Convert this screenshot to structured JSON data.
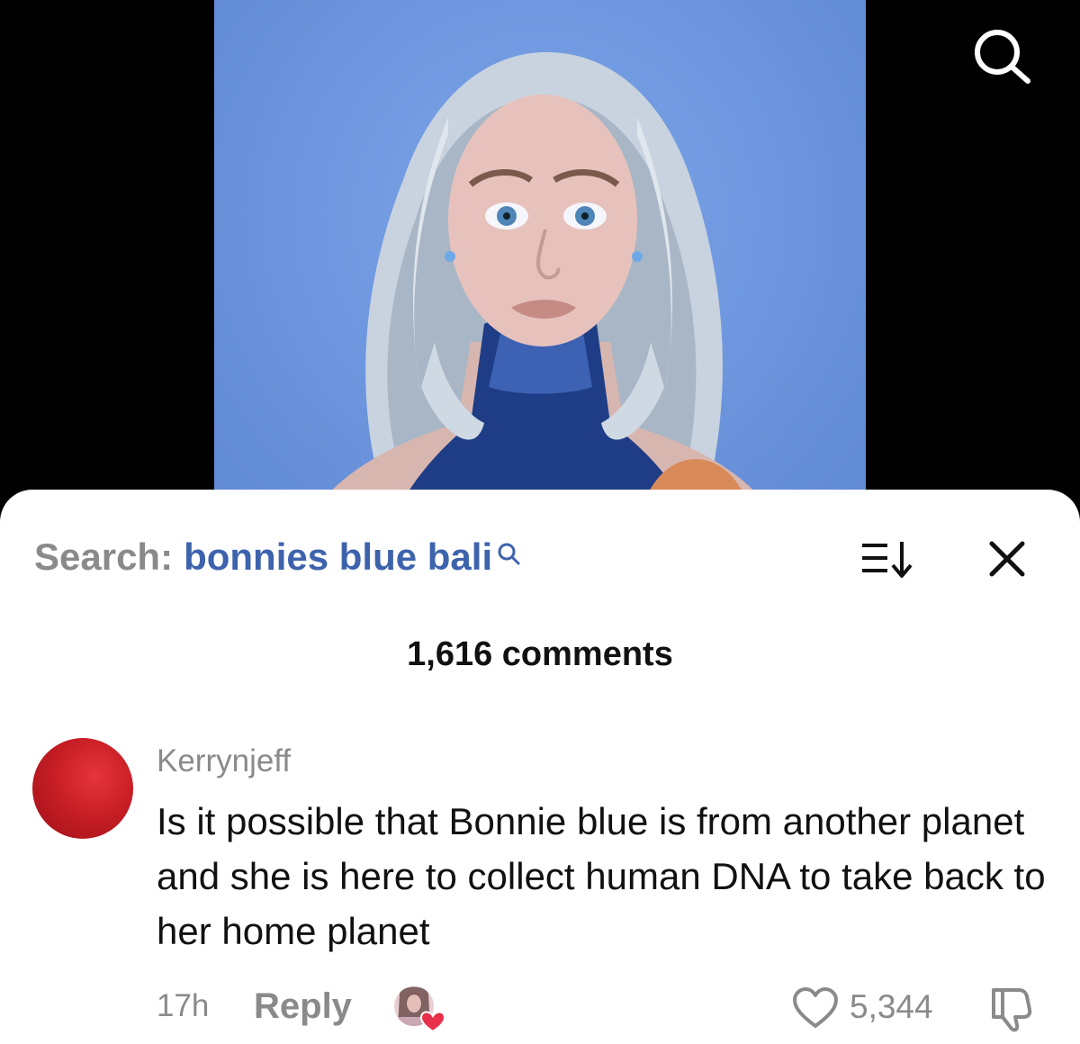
{
  "video": {
    "search_icon": "search-icon"
  },
  "comments_panel": {
    "search_prefix": "Search:",
    "search_query": "bonnies blue bali",
    "sort_icon": "sort-icon",
    "close_icon": "close-icon",
    "comment_count": "1,616 comments"
  },
  "comment": {
    "username": "Kerrynjeff",
    "text": "Is it possible that Bonnie blue is from another planet and she is here to collect human DNA to take back to her home planet",
    "time": "17h",
    "reply_label": "Reply",
    "like_count": "5,344"
  },
  "colors": {
    "query_blue": "#3e63ad",
    "muted_gray": "#8a8a8a",
    "avatar_red": "#c81e25",
    "video_background": "#6f98e0",
    "heart_red": "#e8304a"
  }
}
